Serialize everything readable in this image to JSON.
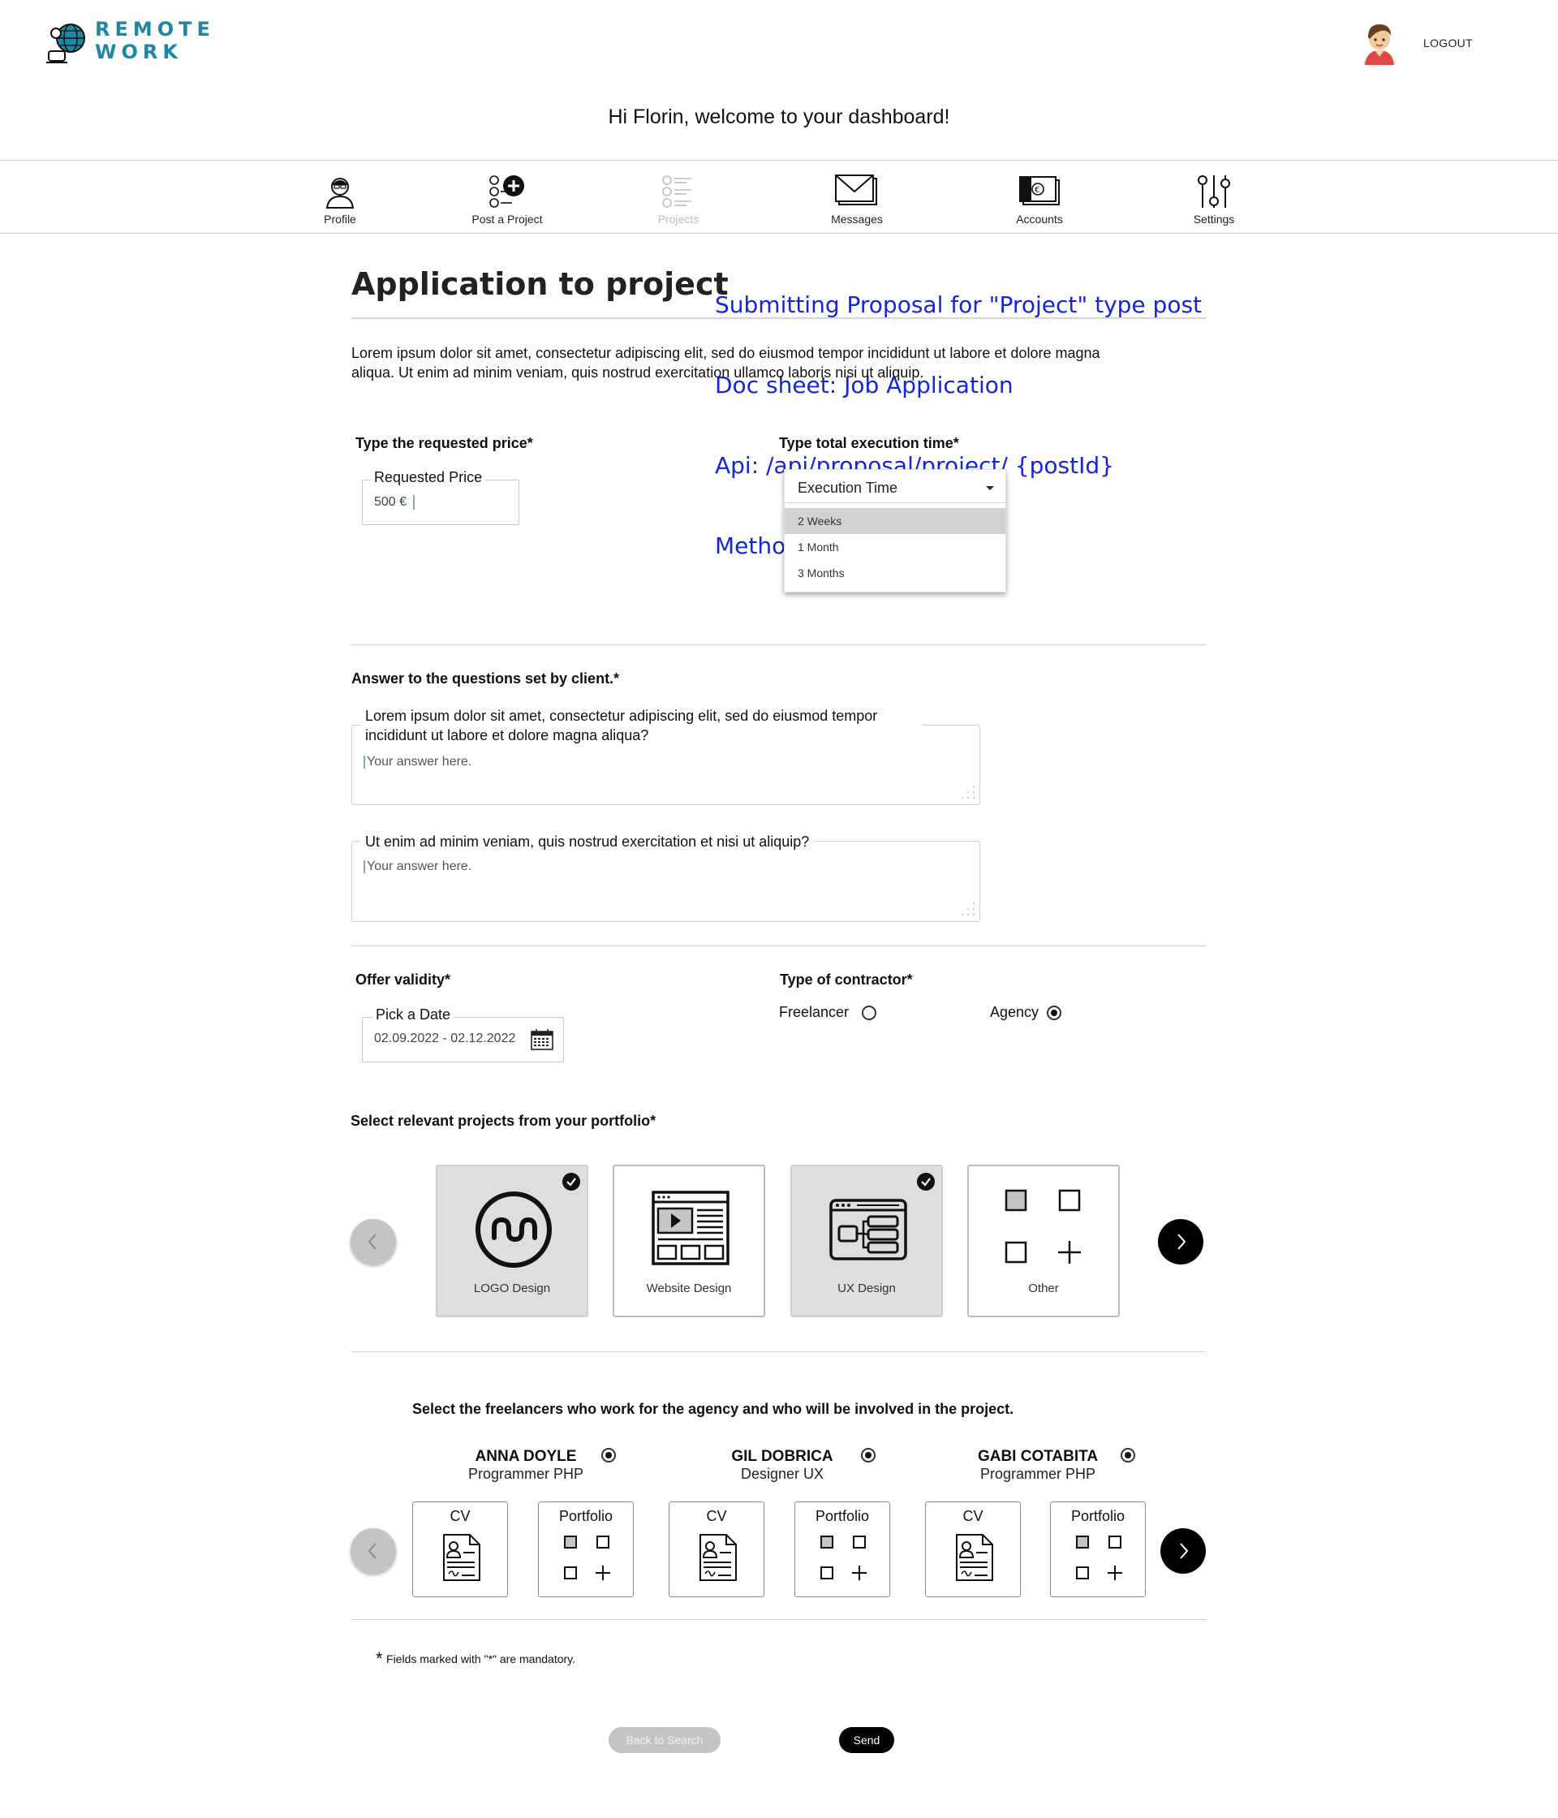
{
  "header": {
    "logo_line1": "REMOTE",
    "logo_line2": "WORK",
    "logout_label": "LOGOUT",
    "welcome": "Hi Florin, welcome to your dashboard!"
  },
  "nav": {
    "items": [
      {
        "label": "Profile",
        "icon": "profile-icon",
        "disabled": false
      },
      {
        "label": "Post a Project",
        "icon": "post-project-icon",
        "disabled": false
      },
      {
        "label": "Projects",
        "icon": "projects-list-icon",
        "disabled": true
      },
      {
        "label": "Messages",
        "icon": "messages-icon",
        "disabled": false
      },
      {
        "label": "Accounts",
        "icon": "accounts-icon",
        "disabled": false
      },
      {
        "label": "Settings",
        "icon": "settings-icon",
        "disabled": false
      }
    ]
  },
  "annotation": {
    "line1": "Submitting Proposal for \"Project\" type post",
    "line2": "Doc sheet: Job Application",
    "line3": "Api: /api/proposal/project/ {postId}",
    "line4": "Method: POST",
    "color": "#1426d6"
  },
  "page": {
    "title": "Application to project",
    "intro": "Lorem ipsum dolor sit amet, consectetur adipiscing elit, sed do eiusmod tempor incididunt ut labore et dolore magna aliqua. Ut enim ad minim veniam, quis nostrud exercitation ullamco laboris nisi ut aliquip."
  },
  "price": {
    "label": "Type the requested price*",
    "legend": "Requested Price",
    "value": "500 €"
  },
  "execution": {
    "label": "Type total execution time*",
    "placeholder": "Execution Time",
    "options": [
      "2 Weeks",
      "1 Month",
      "3 Months"
    ],
    "highlighted": "2 Weeks"
  },
  "questions": {
    "label": "Answer to the questions set by client.*",
    "items": [
      {
        "question": "Lorem ipsum dolor sit amet, consectetur adipiscing elit, sed do eiusmod tempor incididunt ut labore et dolore magna aliqua?",
        "placeholder": "Your answer here."
      },
      {
        "question": "Ut enim ad minim veniam, quis nostrud exercitation et nisi ut aliquip?",
        "placeholder": "Your answer here."
      }
    ]
  },
  "validity": {
    "label": "Offer validity*",
    "legend": "Pick a Date",
    "value": "02.09.2022 - 02.12.2022"
  },
  "contractor": {
    "label": "Type of contractor*",
    "options": [
      {
        "label": "Freelancer",
        "selected": false
      },
      {
        "label": "Agency",
        "selected": true
      }
    ]
  },
  "portfolio": {
    "label": "Select relevant projects from your portfolio*",
    "cards": [
      {
        "caption": "LOGO Design",
        "selected": true,
        "icon": "logo-design-icon"
      },
      {
        "caption": "Website Design",
        "selected": false,
        "icon": "website-design-icon"
      },
      {
        "caption": "UX Design",
        "selected": true,
        "icon": "ux-design-icon"
      },
      {
        "caption": "Other",
        "selected": false,
        "icon": "other-grid-icon"
      }
    ]
  },
  "freelancers": {
    "label": "Select the freelancers who work for the agency and who will be involved in the project.",
    "cv_label": "CV",
    "portfolio_label": "Portfolio",
    "people": [
      {
        "name": "ANNA DOYLE",
        "role": "Programmer PHP",
        "selected": true
      },
      {
        "name": "GIL DOBRICA",
        "role": "Designer UX",
        "selected": true
      },
      {
        "name": "GABI COTABITA",
        "role": "Programmer PHP",
        "selected": true
      }
    ]
  },
  "footer": {
    "mandatory_star": "*",
    "mandatory_note": "Fields marked with \"*\" are mandatory.",
    "back_label": "Back to Search",
    "send_label": "Send"
  }
}
